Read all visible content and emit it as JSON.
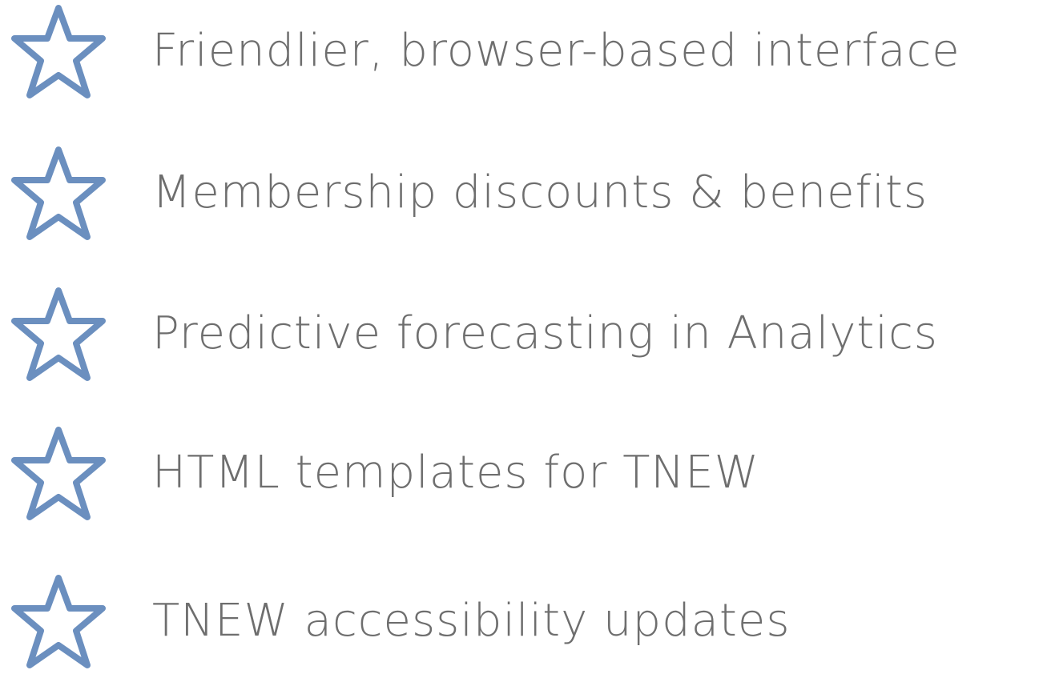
{
  "colors": {
    "star_outline": "#6b8fbf",
    "text": "#6e6e6e",
    "background": "#ffffff"
  },
  "features": [
    {
      "icon": "star-outline-icon",
      "text": "Friendlier, browser-based interface"
    },
    {
      "icon": "star-outline-icon",
      "text": "Membership discounts & benefits"
    },
    {
      "icon": "star-outline-icon",
      "text": "Predictive forecasting in Analytics"
    },
    {
      "icon": "star-outline-icon",
      "text": "HTML templates for TNEW"
    },
    {
      "icon": "star-outline-icon",
      "text": "TNEW accessibility updates"
    }
  ]
}
